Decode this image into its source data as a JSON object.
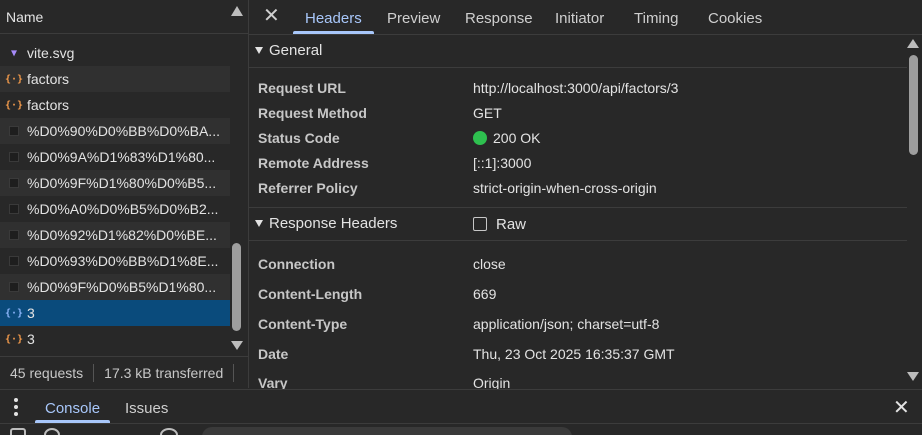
{
  "network": {
    "name_column": "Name",
    "requests": [
      {
        "name": "vite.svg",
        "icon": "svg-file-icon",
        "type": "svg"
      },
      {
        "name": "factors",
        "icon": "json-icon",
        "type": "json"
      },
      {
        "name": "factors",
        "icon": "json-icon",
        "type": "json"
      },
      {
        "name": "%D0%90%D0%BB%D0%BA...",
        "icon": "image-icon",
        "type": "img"
      },
      {
        "name": "%D0%9A%D1%83%D1%80...",
        "icon": "image-icon",
        "type": "img"
      },
      {
        "name": "%D0%9F%D1%80%D0%B5...",
        "icon": "image-icon",
        "type": "img"
      },
      {
        "name": "%D0%A0%D0%B5%D0%B2...",
        "icon": "image-icon",
        "type": "img"
      },
      {
        "name": "%D0%92%D1%82%D0%BE...",
        "icon": "image-icon",
        "type": "img"
      },
      {
        "name": "%D0%93%D0%BB%D1%8E...",
        "icon": "image-icon",
        "type": "img"
      },
      {
        "name": "%D0%9F%D0%B5%D1%80...",
        "icon": "image-icon",
        "type": "img"
      },
      {
        "name": "3",
        "icon": "json-icon",
        "type": "json",
        "selected": true
      },
      {
        "name": "3",
        "icon": "json-icon",
        "type": "json"
      }
    ],
    "status": {
      "requests": "45 requests",
      "transferred": "17.3 kB transferred"
    }
  },
  "details": {
    "tabs": [
      "Headers",
      "Preview",
      "Response",
      "Initiator",
      "Timing",
      "Cookies"
    ],
    "active_tab": "Headers",
    "general": {
      "title": "General",
      "rows": [
        {
          "key": "Request URL",
          "value": "http://localhost:3000/api/factors/3"
        },
        {
          "key": "Request Method",
          "value": "GET"
        },
        {
          "key": "Status Code",
          "value": "200 OK"
        },
        {
          "key": "Remote Address",
          "value": "[::1]:3000"
        },
        {
          "key": "Referrer Policy",
          "value": "strict-origin-when-cross-origin"
        }
      ]
    },
    "response_headers": {
      "title": "Response Headers",
      "raw_label": "Raw",
      "raw_checked": false,
      "rows": [
        {
          "key": "Connection",
          "value": "close"
        },
        {
          "key": "Content-Length",
          "value": "669"
        },
        {
          "key": "Content-Type",
          "value": "application/json; charset=utf-8"
        },
        {
          "key": "Date",
          "value": "Thu, 23 Oct 2025 16:35:37 GMT"
        },
        {
          "key": "Vary",
          "value": "Origin"
        }
      ]
    }
  },
  "drawer": {
    "tabs": [
      "Console",
      "Issues"
    ],
    "active_tab": "Console"
  },
  "colors": {
    "accent": "#a8c7fa",
    "selected_row": "#0a4b7c",
    "status_ok": "#2ec04f"
  }
}
